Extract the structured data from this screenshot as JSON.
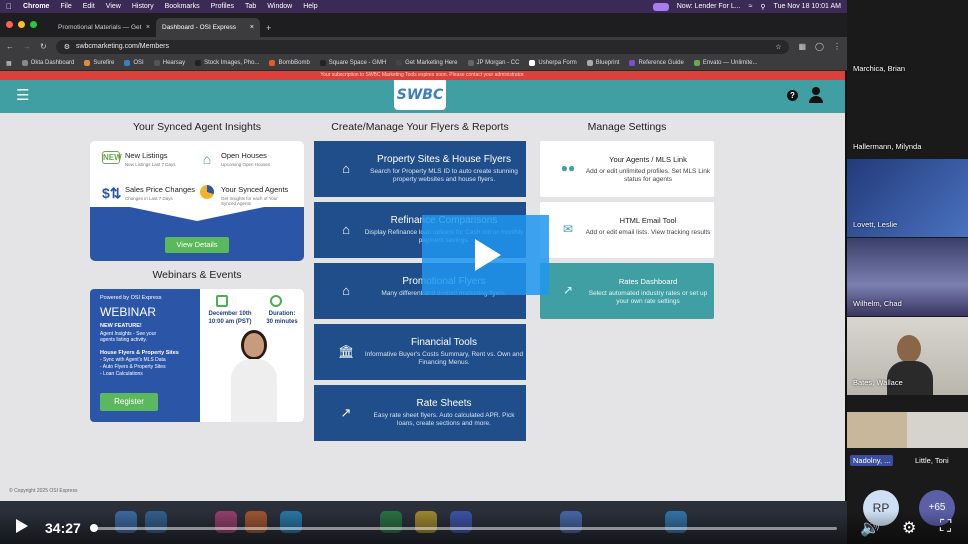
{
  "menubar": {
    "app": "Chrome",
    "items": [
      "File",
      "Edit",
      "View",
      "History",
      "Bookmarks",
      "Profiles",
      "Tab",
      "Window",
      "Help"
    ],
    "now_playing": "Now: Lender For L...",
    "datetime": "Tue Nov 18  10:01 AM"
  },
  "tabs": [
    {
      "label": "Promotional Materials — Get"
    },
    {
      "label": "Dashboard - OSI Express"
    }
  ],
  "address": {
    "url": "swbcmarketing.com/Members"
  },
  "bookmarks": [
    "Okta Dashboard",
    "Surefire",
    "OSI",
    "Hearsay",
    "Stock Images, Pho...",
    "BombBomb",
    "Square Space - GMH",
    "Get Marketing Here",
    "JP Morgan - CC",
    "Usherpa Form",
    "Blueprint",
    "Reference Guide",
    "Envato — Unlimite..."
  ],
  "site": {
    "logo": "SWBC",
    "alert": "Your subscription to SWBC Marketing Tools expires soon. Please contact your administrator.",
    "insights": {
      "title": "Your Synced Agent Insights",
      "items": [
        {
          "title": "New Listings",
          "sub": "New Listings Last 7 Days",
          "icon": "new-badge"
        },
        {
          "title": "Open Houses",
          "sub": "Upcoming Open Houses",
          "icon": "house"
        },
        {
          "title": "Sales Price Changes",
          "sub": "Changes in Last 7 Days",
          "icon": "dollar-arrows"
        },
        {
          "title": "Your Synced Agents",
          "sub": "Get Insights for each of Your Synced Agents",
          "icon": "pie"
        }
      ],
      "button": "View Details"
    },
    "webinars": {
      "title": "Webinars & Events",
      "powered": "Powered by OSI Express",
      "heading": "WEBINAR",
      "feature": "NEW FEATURE!",
      "feature_text": "Agent Insights - See your agents listing activity.",
      "list_title": "House Flyers & Property Sites",
      "list": [
        "Sync with Agent's MLS Data",
        "Auto Flyers & Property Sites",
        "Loan Calculations"
      ],
      "date": "December 10th",
      "time": "10:00 am (PST)",
      "duration_label": "Duration:",
      "duration": "30 minutes",
      "button": "Register"
    },
    "flyers": {
      "title": "Create/Manage Your Flyers & Reports",
      "items": [
        {
          "title": "Property Sites & House Flyers",
          "desc": "Search for Property MLS ID to auto create stunning property websites and house flyers."
        },
        {
          "title": "Refinance Comparisons",
          "desc": "Display Refinance loan options for Cash out or monthly payment savings."
        },
        {
          "title": "Promotional Flyers",
          "desc": "Many different and distinct marketing flyers."
        },
        {
          "title": "Financial Tools",
          "desc": "Informative Buyer's Costs Summary, Rent vs. Own and Financing Menus."
        },
        {
          "title": "Rate Sheets",
          "desc": "Easy rate sheet flyers. Auto calculated APR. Pick loans, create sections and more."
        }
      ]
    },
    "settings": {
      "title": "Manage Settings",
      "items": [
        {
          "title": "Your Agents / MLS Link",
          "desc": "Add or edit unlimited profiles. Set MLS Link status for agents"
        },
        {
          "title": "HTML Email Tool",
          "desc": "Add or edit email lists. View tracking results"
        },
        {
          "title": "Rates Dashboard",
          "desc": "Select automated industry rates or set up your own rate settings"
        }
      ]
    },
    "copyright": "© Copyright 2025 OSI Express"
  },
  "participants": [
    "Marchica, Brian",
    "Hallermann, Milynda",
    "Lovett, Leslie",
    "Wilhelm, Chad",
    "Bates, Wallace",
    "Nadolny, ...",
    "Little, Toni"
  ],
  "avatars": [
    {
      "initials": "RP",
      "sub": "R..."
    },
    {
      "label": "+65"
    }
  ],
  "player": {
    "time": "34:27",
    "progress": 0.0
  }
}
